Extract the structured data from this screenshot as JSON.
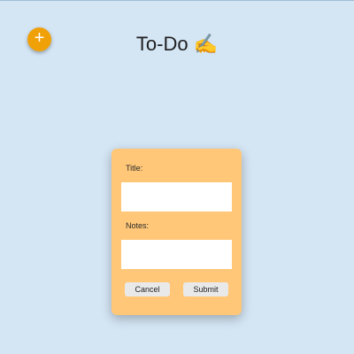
{
  "header": {
    "add_button_label": "+",
    "title": "To-Do ✍️"
  },
  "form": {
    "title_label": "Title:",
    "title_value": "",
    "notes_label": "Notes:",
    "notes_value": "",
    "cancel_label": "Cancel",
    "submit_label": "Submit"
  },
  "colors": {
    "background": "#d4e5f4",
    "accent": "#f0a108",
    "card": "#ffc777"
  }
}
